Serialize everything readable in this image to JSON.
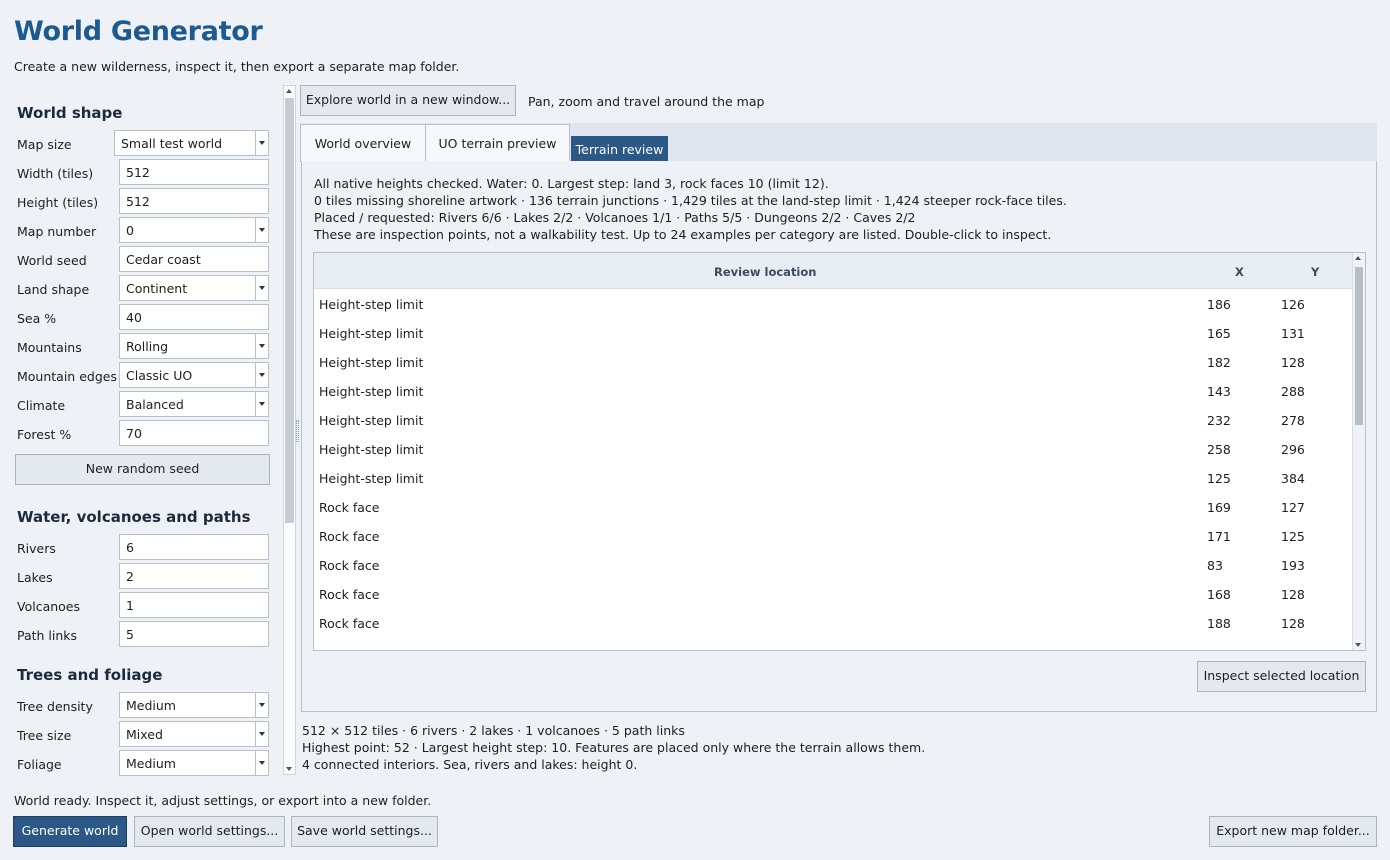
{
  "app": {
    "title": "World Generator",
    "subtitle": "Create a new wilderness, inspect it, then export a separate map folder."
  },
  "world_shape": {
    "heading": "World shape",
    "map_size": {
      "label": "Map size",
      "value": "Small test world"
    },
    "width": {
      "label": "Width (tiles)",
      "value": "512"
    },
    "height": {
      "label": "Height (tiles)",
      "value": "512"
    },
    "map_number": {
      "label": "Map number",
      "value": "0"
    },
    "world_seed": {
      "label": "World seed",
      "value": "Cedar coast"
    },
    "land_shape": {
      "label": "Land shape",
      "value": "Continent"
    },
    "sea": {
      "label": "Sea %",
      "value": "40"
    },
    "mountains": {
      "label": "Mountains",
      "value": "Rolling"
    },
    "mountain_edges": {
      "label": "Mountain edges",
      "value": "Classic UO"
    },
    "climate": {
      "label": "Climate",
      "value": "Balanced"
    },
    "forest": {
      "label": "Forest %",
      "value": "70"
    },
    "random_seed_button": "New random seed"
  },
  "water": {
    "heading": "Water, volcanoes and paths",
    "rivers": {
      "label": "Rivers",
      "value": "6"
    },
    "lakes": {
      "label": "Lakes",
      "value": "2"
    },
    "volcanoes": {
      "label": "Volcanoes",
      "value": "1"
    },
    "path_links": {
      "label": "Path links",
      "value": "5"
    }
  },
  "trees": {
    "heading": "Trees and foliage",
    "tree_density": {
      "label": "Tree density",
      "value": "Medium"
    },
    "tree_size": {
      "label": "Tree size",
      "value": "Mixed"
    },
    "foliage": {
      "label": "Foliage",
      "value": "Medium"
    }
  },
  "explore": {
    "button": "Explore world in a new window...",
    "hint": "Pan, zoom and travel around the map"
  },
  "tabs": [
    "World overview",
    "UO terrain preview",
    "Terrain review"
  ],
  "review": {
    "lines": [
      "All native heights checked. Water: 0. Largest step: land 3, rock faces 10 (limit 12).",
      "0 tiles missing shoreline artwork · 136 terrain junctions · 1,429 tiles at the land-step limit · 1,424 steeper rock-face tiles.",
      "Placed / requested: Rivers 6/6 · Lakes 2/2 · Volcanoes 1/1 · Paths 5/5 · Dungeons 2/2 · Caves 2/2",
      "These are inspection points, not a walkability test. Up to 24 examples per category are listed. Double-click to inspect."
    ],
    "columns": [
      "Review location",
      "X",
      "Y"
    ],
    "rows": [
      [
        "Height-step limit",
        "186",
        "126"
      ],
      [
        "Height-step limit",
        "165",
        "131"
      ],
      [
        "Height-step limit",
        "182",
        "128"
      ],
      [
        "Height-step limit",
        "143",
        "288"
      ],
      [
        "Height-step limit",
        "232",
        "278"
      ],
      [
        "Height-step limit",
        "258",
        "296"
      ],
      [
        "Height-step limit",
        "125",
        "384"
      ],
      [
        "Rock face",
        "169",
        "127"
      ],
      [
        "Rock face",
        "171",
        "125"
      ],
      [
        "Rock face",
        "83",
        "193"
      ],
      [
        "Rock face",
        "168",
        "128"
      ],
      [
        "Rock face",
        "188",
        "128"
      ]
    ],
    "inspect_button": "Inspect selected location"
  },
  "summary": [
    "512 × 512 tiles · 6 rivers · 2 lakes · 1 volcanoes · 5 path links",
    "Highest point: 52 · Largest height step: 10. Features are placed only where the terrain allows them.",
    "4 connected interiors. Sea, rivers and lakes: height 0."
  ],
  "status": "World ready. Inspect it, adjust settings, or export into a new folder.",
  "buttons": {
    "generate": "Generate world",
    "open_settings": "Open world settings...",
    "save_settings": "Save world settings...",
    "export": "Export new map folder..."
  }
}
